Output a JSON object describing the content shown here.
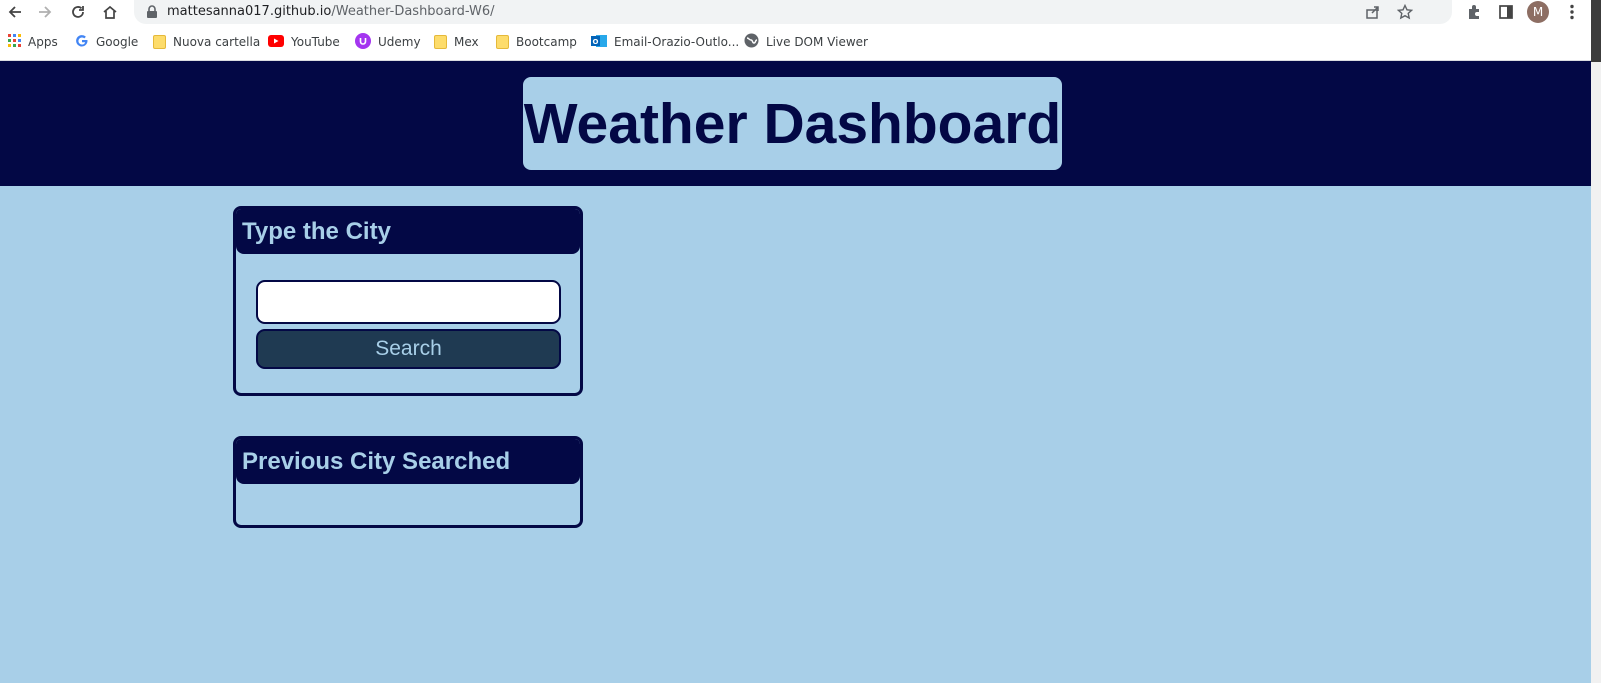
{
  "browser": {
    "url_host": "mattesanna017.github.io",
    "url_path": "/Weather-Dashboard-W6/",
    "profile_initial": "M",
    "icons": [
      "back-arrow-icon",
      "forward-arrow-icon",
      "reload-icon",
      "home-icon",
      "lock-icon",
      "share-icon",
      "star-icon",
      "extensions-icon",
      "side-panel-icon",
      "menu-dots-icon"
    ]
  },
  "bookmarks": [
    {
      "label": "Apps",
      "icon": "apps-grid-icon"
    },
    {
      "label": "Google",
      "icon": "google-icon"
    },
    {
      "label": "Nuova cartella",
      "icon": "folder-icon"
    },
    {
      "label": "YouTube",
      "icon": "youtube-icon"
    },
    {
      "label": "Udemy",
      "icon": "udemy-icon"
    },
    {
      "label": "Mex",
      "icon": "folder-icon"
    },
    {
      "label": "Bootcamp",
      "icon": "folder-icon"
    },
    {
      "label": "Email-Orazio-Outlo...",
      "icon": "outlook-icon"
    },
    {
      "label": "Live DOM Viewer",
      "icon": "globe-icon"
    }
  ],
  "page": {
    "title": "Weather Dashboard",
    "search_card": {
      "heading": "Type the City",
      "input_value": "",
      "button_label": "Search"
    },
    "history_card": {
      "heading": "Previous City Searched",
      "items": []
    }
  },
  "colors": {
    "navy": "#030845",
    "light_blue": "#a8cfe8",
    "button_bg": "#1f3a52"
  }
}
